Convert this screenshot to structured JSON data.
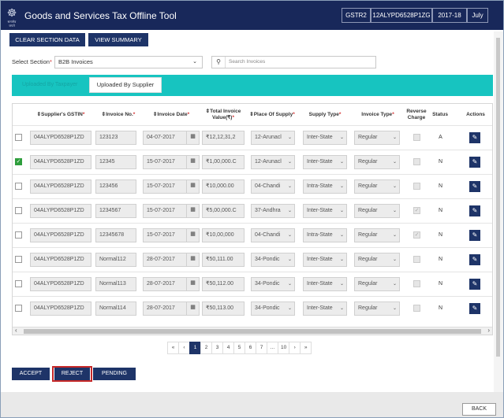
{
  "header": {
    "title": "Goods and Services Tax Offline Tool",
    "logo_line": "सत्यमेव जयते",
    "return_type": "GSTR2",
    "gstin": "12ALYPD6528P1ZG",
    "year": "2017-18",
    "month": "July"
  },
  "toolbar": {
    "clear_label": "CLEAR SECTION DATA",
    "summary_label": "VIEW SUMMARY"
  },
  "section": {
    "label": "Select Section",
    "value": "B2B Invoices",
    "search_placeholder": "Search Invoices"
  },
  "tabs": {
    "taxpayer": "Uploaded By Taxpayer",
    "supplier": "Uploaded By Supplier"
  },
  "table": {
    "headers": {
      "gstin": "Supplier's GSTIN",
      "inv_no": "Invoice No.",
      "inv_date": "Invoice Date",
      "total": "Total Invoice Value(₹)",
      "pos": "Place Of Supply",
      "supply": "Supply Type",
      "inv_type": "Invoice Type",
      "reverse": "Reverse Charge",
      "status": "Status",
      "actions": "Actions"
    },
    "rows": [
      {
        "checked": false,
        "gstin": "04ALYPD6528P1ZD",
        "inv_no": "123123",
        "date": "04-07-2017",
        "total": "₹12,12,31,2",
        "pos": "12-Arunacl",
        "supply": "Inter-State",
        "type": "Regular",
        "reverse": false,
        "status": "A"
      },
      {
        "checked": true,
        "gstin": "04ALYPD6528P1ZD",
        "inv_no": "12345",
        "date": "15-07-2017",
        "total": "₹1,00,000.C",
        "pos": "12-Arunacl",
        "supply": "Inter-State",
        "type": "Regular",
        "reverse": false,
        "status": "N"
      },
      {
        "checked": false,
        "gstin": "04ALYPD6528P1ZD",
        "inv_no": "123456",
        "date": "15-07-2017",
        "total": "₹10,000.00",
        "pos": "04-Chandi",
        "supply": "Intra-State",
        "type": "Regular",
        "reverse": false,
        "status": "N"
      },
      {
        "checked": false,
        "gstin": "04ALYPD6528P1ZD",
        "inv_no": "1234567",
        "date": "15-07-2017",
        "total": "₹5,00,000.C",
        "pos": "37-Andhra",
        "supply": "Inter-State",
        "type": "Regular",
        "reverse": true,
        "status": "N"
      },
      {
        "checked": false,
        "gstin": "04ALYPD6528P1ZD",
        "inv_no": "12345678",
        "date": "15-07-2017",
        "total": "₹10,00,000",
        "pos": "04-Chandi",
        "supply": "Intra-State",
        "type": "Regular",
        "reverse": true,
        "status": "N"
      },
      {
        "checked": false,
        "gstin": "04ALYPD6528P1ZD",
        "inv_no": "Normal112",
        "date": "28-07-2017",
        "total": "₹50,111.00",
        "pos": "34-Pondic",
        "supply": "Inter-State",
        "type": "Regular",
        "reverse": false,
        "status": "N"
      },
      {
        "checked": false,
        "gstin": "04ALYPD6528P1ZD",
        "inv_no": "Normal113",
        "date": "28-07-2017",
        "total": "₹50,112.00",
        "pos": "34-Pondic",
        "supply": "Inter-State",
        "type": "Regular",
        "reverse": false,
        "status": "N"
      },
      {
        "checked": false,
        "gstin": "04ALYPD6528P1ZD",
        "inv_no": "Normal114",
        "date": "28-07-2017",
        "total": "₹50,113.00",
        "pos": "34-Pondic",
        "supply": "Inter-State",
        "type": "Regular",
        "reverse": false,
        "status": "N"
      }
    ]
  },
  "pagination": [
    "«",
    "‹",
    "1",
    "2",
    "3",
    "4",
    "5",
    "6",
    "7",
    "...",
    "10",
    "›",
    "»"
  ],
  "actions": {
    "accept": "ACCEPT",
    "reject": "REJECT",
    "pending": "PENDING",
    "back": "BACK"
  },
  "colors": {
    "navy": "#1e3468",
    "teal": "#17c4c0",
    "title_bar": "#18285a",
    "reject_outline": "#c62828"
  }
}
